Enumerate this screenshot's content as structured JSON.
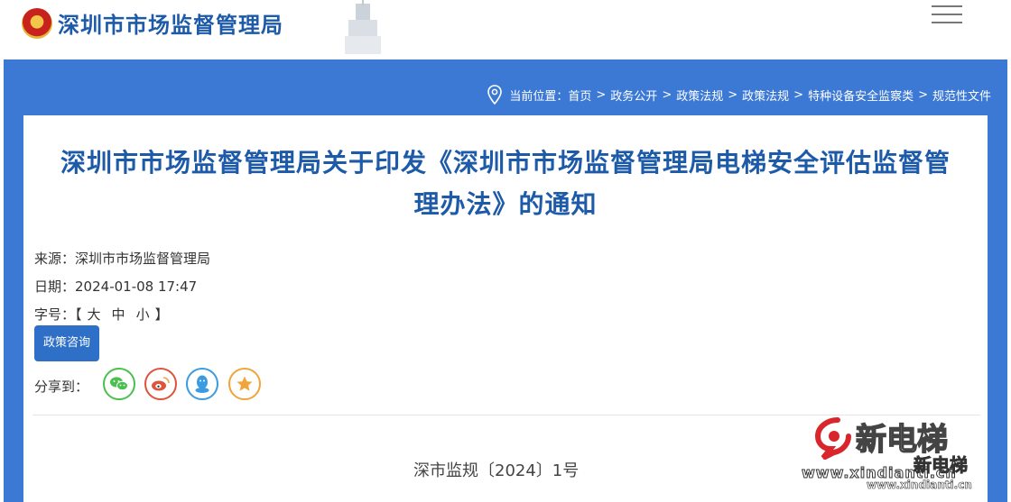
{
  "header": {
    "site_title": "深圳市市场监督管理局",
    "menu_icon": "hamburger-menu-icon",
    "emblem_icon": "police-emblem-icon"
  },
  "breadcrumb": {
    "prefix": "当前位置：",
    "items": [
      "首页",
      "政务公开",
      "政策法规",
      "政策法规",
      "特种设备安全监察类",
      "规范性文件"
    ],
    "separator": ">"
  },
  "article": {
    "title_line1": "深圳市市场监督管理局关于印发《深圳市市场监督管理局电梯安全评估监督管",
    "title_line2": "理办法》的通知",
    "source_label": "来源：",
    "source_value": "深圳市市场监督管理局",
    "date_label": "日期：",
    "date_value": "2024-01-08 17:47",
    "font_label": "字号：",
    "font_open": "【",
    "font_large": "大",
    "font_medium": "中",
    "font_small": "小",
    "font_close": "】",
    "consult_label": "政策咨询",
    "share_label": "分享到：",
    "doc_number": "深市监规〔2024〕1号"
  },
  "share_icons": [
    "wechat-icon",
    "weibo-icon",
    "qq-icon",
    "favorite-icon"
  ],
  "watermark": {
    "brand": "新电梯",
    "url": "www.xindianti.cn",
    "brand2": "新电梯",
    "url2": "www.xindianti.cn"
  },
  "colors": {
    "primary": "#3b79d4",
    "title": "#1d5aa8",
    "button": "#2e6fc7",
    "wechat": "#4bbf4f",
    "weibo": "#e0533b",
    "qq": "#3a9be0",
    "favorite": "#f0a53a"
  }
}
